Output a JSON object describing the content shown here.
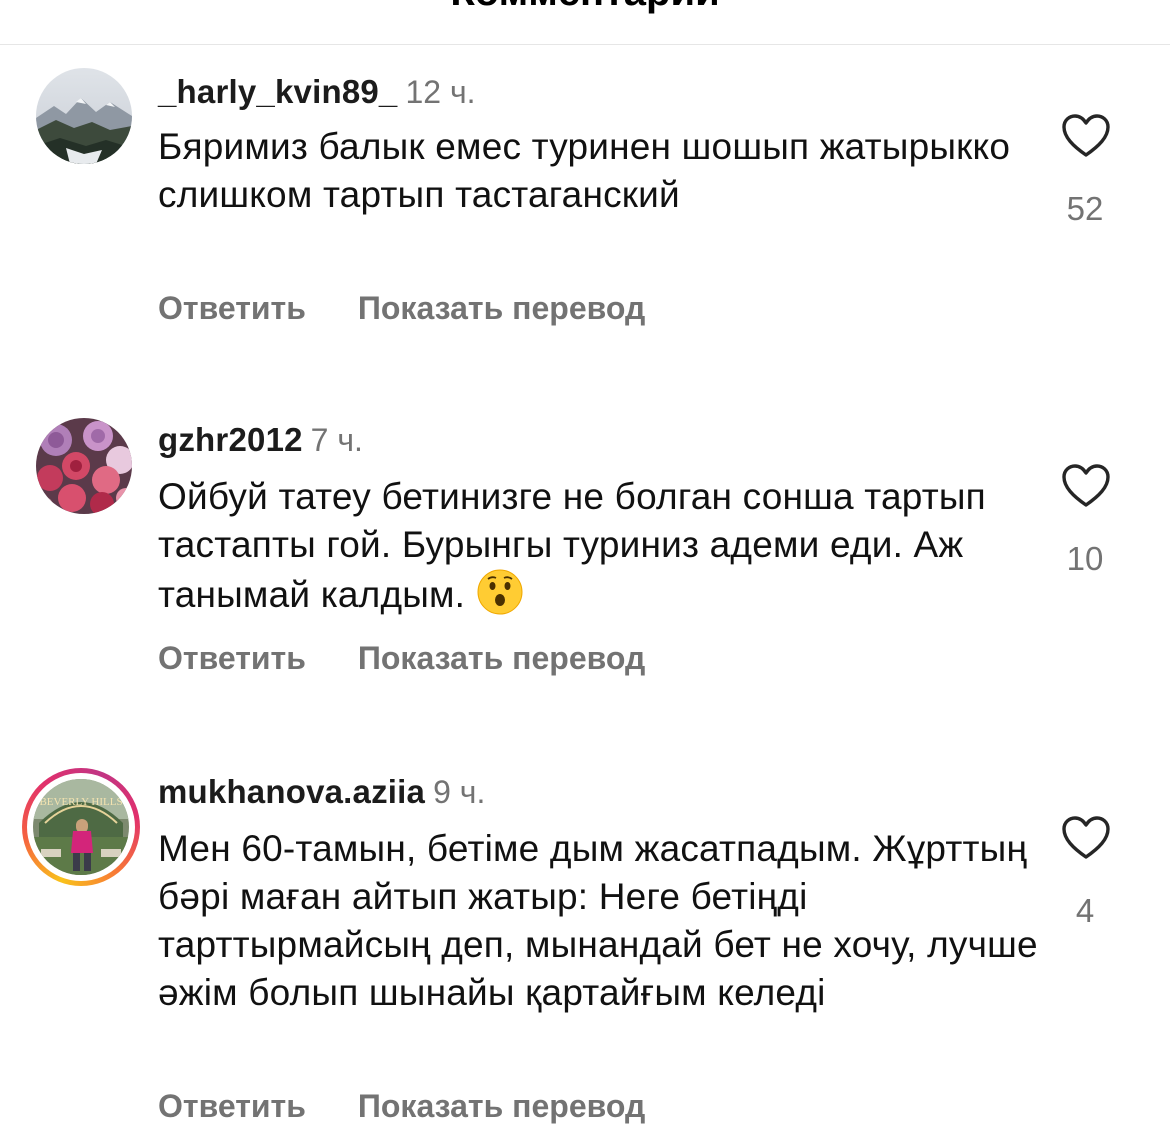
{
  "top_bar": {
    "title": "Комментарии"
  },
  "comments": [
    {
      "username": "_harly_kvin89_",
      "time": "12 ч.",
      "text": "Бяримиз балык емес туринен шошып жатырыкко слишком тартып тастаганский",
      "reply_label": "Ответить",
      "translate_label": "Показать перевод",
      "likes": "52",
      "avatar": "mountain-landscape"
    },
    {
      "username": "gzhr2012",
      "time": "7 ч.",
      "text": "Ойбуй татеу бетинизге не болган сонша тартып тастапты гой. Бурынгы туриниз адеми еди. Аж танымай калдым.",
      "emoji": "astonished-face",
      "reply_label": "Ответить",
      "translate_label": "Показать перевод",
      "likes": "10",
      "avatar": "roses"
    },
    {
      "username": "mukhanova.aziia",
      "time": "9 ч.",
      "text": "Мен 60-тамын, бетіме дым жасатпадым. Жұрттың бәрі маған айтып жатыр: Неге бетіңді тарттырмайсың деп, мынандай бет не хочу, лучше әжім болып шынайы қартайғым келеді",
      "reply_label": "Ответить",
      "translate_label": "Показать перевод",
      "likes": "4",
      "avatar": "beverly-hills-sign",
      "avatar_text": "BEVERLY HILLS",
      "has_story": true
    }
  ],
  "colors": {
    "secondary_text": "#737373",
    "story_ring": "#e1306c"
  }
}
